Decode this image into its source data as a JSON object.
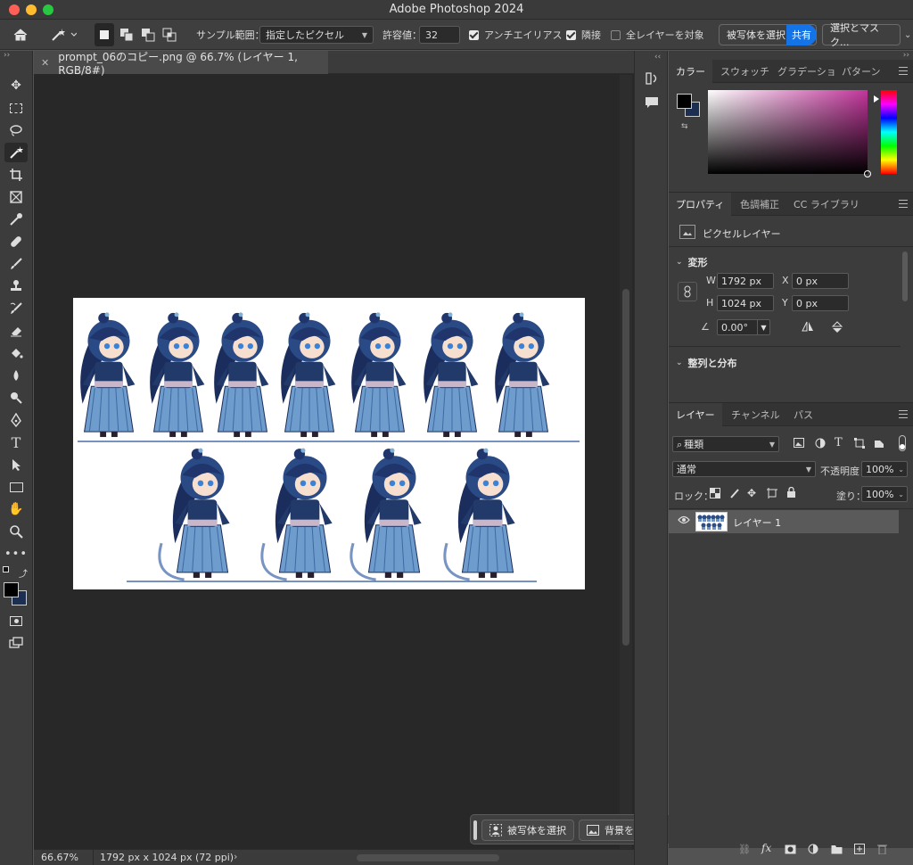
{
  "app": {
    "title": "Adobe Photoshop 2024"
  },
  "options": {
    "sample_label": "サンプル範囲：",
    "sample_value": "指定したピクセル",
    "tolerance_label": "許容値：",
    "tolerance_value": "32",
    "antialias": "アンチエイリアス",
    "contiguous": "隣接",
    "all_layers": "全レイヤーを対象",
    "select_subject": "被写体を選択",
    "share": "共有",
    "select_mask": "選択とマスク..."
  },
  "document": {
    "tab_title": "prompt_06のコピー.png @ 66.7% (レイヤー 1, RGB/8#)"
  },
  "status": {
    "zoom": "66.67%",
    "info": "1792 px x 1024 px (72 ppi)"
  },
  "color_panel": {
    "tabs": [
      "カラー",
      "スウォッチ",
      "グラデーショ",
      "パターン"
    ]
  },
  "properties_panel": {
    "tabs": [
      "プロパティ",
      "色調補正",
      "CC ライブラリ"
    ],
    "layer_type": "ピクセルレイヤー",
    "transform_title": "変形",
    "w_label": "W",
    "w_value": "1792 px",
    "h_label": "H",
    "h_value": "1024 px",
    "x_label": "X",
    "x_value": "0 px",
    "y_label": "Y",
    "y_value": "0 px",
    "angle_value": "0.00°",
    "align_title": "整列と分布"
  },
  "layers_panel": {
    "tabs": [
      "レイヤー",
      "チャンネル",
      "パス"
    ],
    "filter_kind": "種類",
    "blend_mode": "通常",
    "opacity_label": "不透明度：",
    "opacity_value": "100%",
    "lock_label": "ロック：",
    "fill_label": "塗り：",
    "fill_value": "100%",
    "layer_name": "レイヤー 1"
  },
  "contextual_bar": {
    "select_subject": "被写体を選択",
    "remove_bg": "背景を削除"
  },
  "colors": {
    "accent": "#1473e6",
    "foreground": "#000000",
    "background": "#1c2f52"
  }
}
